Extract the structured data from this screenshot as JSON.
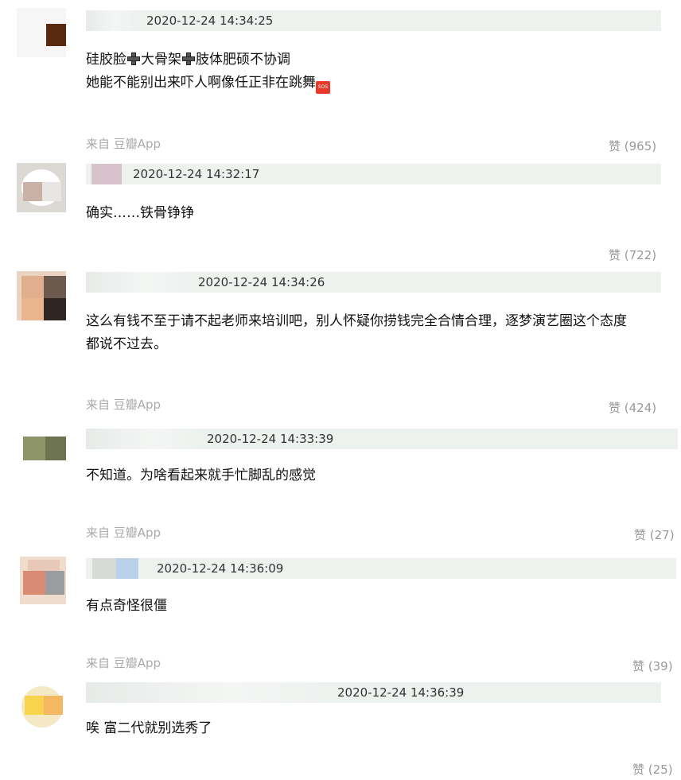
{
  "comments": [
    {
      "time": "2020-12-24 14:34:25",
      "line1_a": "硅胶脸",
      "line1_b": "大骨架",
      "line1_c": "肢体肥硕不协调",
      "line2": "她能不能别出来吓人啊像任正非在跳舞",
      "sos_text": "SOS",
      "source": "来自 豆瓣App",
      "likes": "赞 (965)"
    },
    {
      "time": "2020-12-24 14:32:17",
      "text": "确实……铁骨铮铮",
      "likes": "赞 (722)"
    },
    {
      "time": "2020-12-24 14:34:26",
      "line1": "这么有钱不至于请不起老师来培训吧，别人怀疑你捞钱完全合情合理，逐梦演艺圈这个态度",
      "line2": "都说不过去。",
      "source": "来自 豆瓣App",
      "likes": "赞 (424)"
    },
    {
      "time": "2020-12-24 14:33:39",
      "text": "不知道。为啥看起来就手忙脚乱的感觉",
      "source": "来自 豆瓣App",
      "likes": "赞 (27)"
    },
    {
      "time": "2020-12-24 14:36:09",
      "text": "有点奇怪很僵",
      "source": "来自 豆瓣App",
      "likes": "赞 (39)"
    },
    {
      "time": "2020-12-24 14:36:39",
      "text": "唉 富二代就别选秀了",
      "likes": "赞 (25)"
    }
  ],
  "colors": {
    "meta_bar": "#eef2ef",
    "source_text": "#aaaaaa",
    "likes_text": "#999999"
  }
}
